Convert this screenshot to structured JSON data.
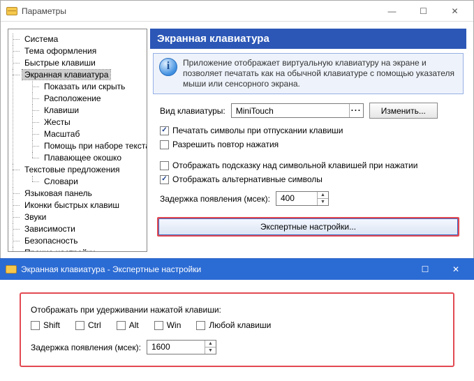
{
  "window": {
    "title": "Параметры",
    "min": "—",
    "max": "☐",
    "close": "✕"
  },
  "tree": {
    "items": [
      "Система",
      "Тема оформления",
      "Быстрые клавиши"
    ],
    "osk": {
      "label": "Экранная клавиатура",
      "children": [
        "Показать или скрыть",
        "Расположение",
        "Клавиши",
        "Жесты",
        "Масштаб",
        "Помощь при наборе текста",
        "Плавающее окошко"
      ]
    },
    "text_sugg": {
      "label": "Текстовые предложения",
      "children": [
        "Словари"
      ]
    },
    "rest": [
      "Языковая панель",
      "Иконки быстрых клавиш",
      "Звуки",
      "Зависимости",
      "Безопасность",
      "Прочие настройки"
    ]
  },
  "panel": {
    "title": "Экранная клавиатура",
    "info": "Приложение отображает виртуальную клавиатуру на экране и позволяет печатать как на обычной клавиатуре с помощью указателя мыши или сенсорного экрана.",
    "layout_label": "Вид клавиатуры:",
    "layout_value": "MiniTouch",
    "change_btn": "Изменить...",
    "chk_release": "Печатать символы при отпускании клавиши",
    "chk_repeat": "Разрешить повтор нажатия",
    "chk_hint": "Отображать подсказку над символьной клавишей при нажатии",
    "chk_alt": "Отображать альтернативные символы",
    "delay_label": "Задержка появления (мсек):",
    "delay_value": "400",
    "expert_btn": "Экспертные настройки..."
  },
  "child": {
    "title": "Экранная клавиатура - Экспертные настройки",
    "heading": "Отображать при удерживании нажатой клавиши:",
    "mods": [
      "Shift",
      "Ctrl",
      "Alt",
      "Win",
      "Любой клавиши"
    ],
    "delay_label": "Задержка появления (мсек):",
    "delay_value": "1600"
  }
}
